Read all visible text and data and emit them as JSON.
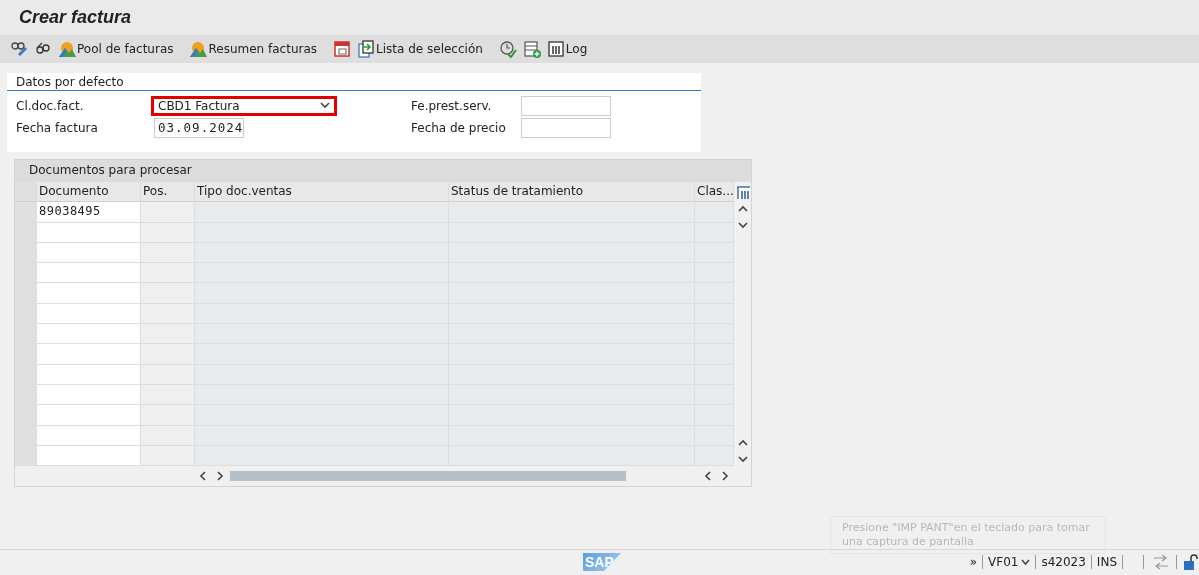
{
  "window": {
    "title": "Crear factura"
  },
  "toolbar": [
    {
      "kind": "icon"
    },
    {
      "kind": "icon"
    },
    {
      "kind": "labeled",
      "label": "Pool de facturas"
    },
    {
      "kind": "labeled",
      "label": "Resumen facturas"
    },
    {
      "kind": "icon"
    },
    {
      "kind": "labeled",
      "label": "Lista de selección"
    },
    {
      "kind": "icon"
    },
    {
      "kind": "icon"
    },
    {
      "kind": "labeled",
      "label": "Log"
    }
  ],
  "defaults": {
    "title": "Datos por defecto",
    "fields": [
      {
        "label": "Cl.doc.fact.",
        "kind": "dropdown",
        "value": "CBD1 Factura",
        "highlighted": true
      },
      {
        "label": "Fe.prest.serv.",
        "kind": "input"
      },
      {
        "label": "Fecha factura",
        "kind": "input",
        "value": "03.09.2024"
      },
      {
        "label": "Fecha de precio",
        "kind": "input"
      }
    ]
  },
  "table": {
    "title": "Documentos para procesar",
    "columns": [
      "Documento",
      "Pos.",
      "Tipo doc.ventas",
      "Status de tratamiento",
      "Clas..."
    ],
    "rows": [
      {
        "documento": "89038495"
      },
      {},
      {},
      {},
      {},
      {},
      {},
      {},
      {},
      {},
      {},
      {},
      {}
    ]
  },
  "status_bar": {
    "items": [
      "»",
      "VF01",
      "s42023",
      "INS"
    ],
    "logo": "SAP"
  },
  "toast": {
    "text": "Presione \"IMP PANT\"en el teclado para tomar una captura de pantalla"
  }
}
